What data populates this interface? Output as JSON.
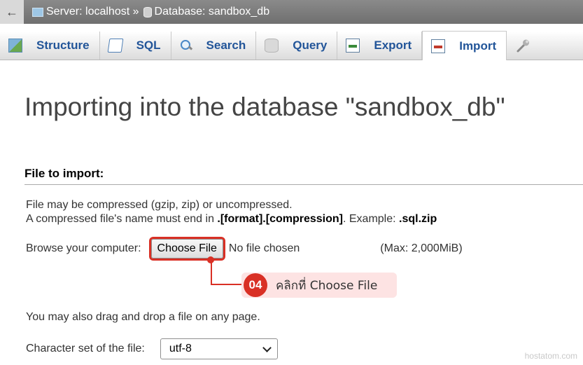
{
  "breadcrumb": {
    "back_arrow": "←",
    "server": "Server: localhost »",
    "database": "Database: sandbox_db"
  },
  "tabs": [
    {
      "label": "Structure",
      "icon": "structure-icon"
    },
    {
      "label": "SQL",
      "icon": "sql-icon"
    },
    {
      "label": "Search",
      "icon": "search-icon"
    },
    {
      "label": "Query",
      "icon": "query-icon"
    },
    {
      "label": "Export",
      "icon": "export-icon"
    },
    {
      "label": "Import",
      "icon": "import-icon",
      "active": true
    },
    {
      "label": "",
      "icon": "wrench-icon"
    }
  ],
  "main": {
    "title": "Importing into the database \"sandbox_db\"",
    "section_legend": "File to import:",
    "compression_line": "File may be compressed (gzip, zip) or uncompressed.",
    "name_line_prefix": "A compressed file's name must end in ",
    "name_line_format": ".[format].[compression]",
    "name_line_mid": ". Example: ",
    "name_line_example": ".sql.zip",
    "browse_label": "Browse your computer:",
    "choose_file_button": "Choose File",
    "no_file_text": "No file chosen",
    "max_size": "(Max: 2,000MiB)",
    "drag_drop_text": "You may also drag and drop a file on any page.",
    "charset_label": "Character set of the file:",
    "charset_value": "utf-8"
  },
  "annotation": {
    "step_number": "04",
    "step_text": "คลิกที่ Choose File",
    "color": "#d93025"
  },
  "watermark": "hostatom.com"
}
